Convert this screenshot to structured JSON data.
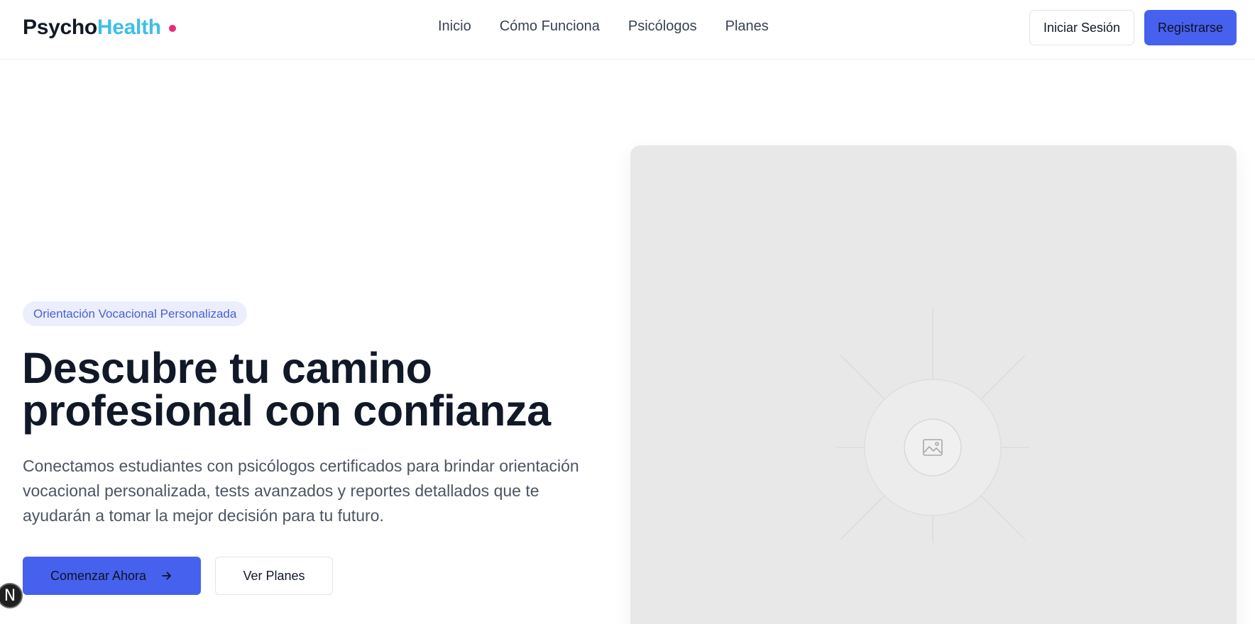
{
  "header": {
    "logo_part1": "Psycho",
    "logo_part2": "Health",
    "nav": [
      {
        "label": "Inicio"
      },
      {
        "label": "Cómo Funciona"
      },
      {
        "label": "Psicólogos"
      },
      {
        "label": "Planes"
      }
    ],
    "login_label": "Iniciar Sesión",
    "register_label": "Registrarse"
  },
  "hero": {
    "badge": "Orientación Vocacional Personalizada",
    "title_line1": "Descubre tu camino",
    "title_line2": "profesional con confianza",
    "description": "Conectamos estudiantes con psicólogos certificados para brindar orientación vocacional personalizada, tests avanzados y reportes detallados que te ayudarán a tomar la mejor decisión para tu futuro.",
    "primary_button": "Comenzar Ahora",
    "primary_button_icon": "arrow-right-icon",
    "secondary_button": "Ver Planes",
    "image_icon": "image-icon"
  },
  "dev_badge": {
    "label": "N"
  },
  "colors": {
    "brand_primary": "#4661ee",
    "logo_accent": "#3fbfe6",
    "logo_dot": "#ec2a7a",
    "badge_bg": "#ebeefd",
    "placeholder_bg": "#e8e8e8"
  }
}
